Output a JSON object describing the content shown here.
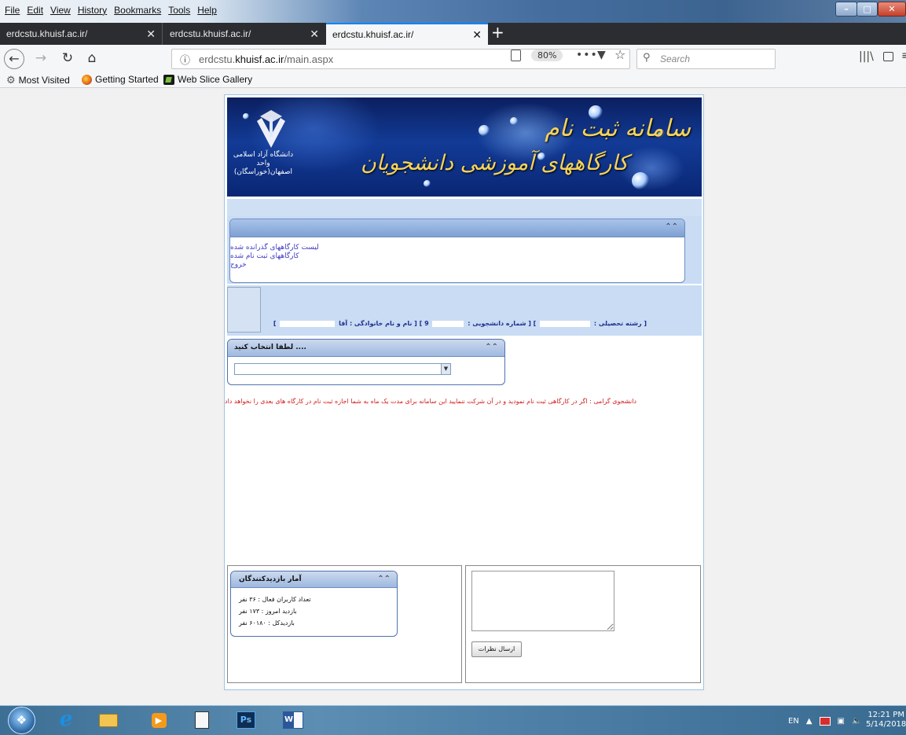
{
  "browser": {
    "menu": [
      "File",
      "Edit",
      "View",
      "History",
      "Bookmarks",
      "Tools",
      "Help"
    ],
    "tabs": [
      {
        "title": "erdcstu.khuisf.ac.ir/"
      },
      {
        "title": "erdcstu.khuisf.ac.ir/"
      },
      {
        "title": "erdcstu.khuisf.ac.ir/"
      }
    ],
    "new_tab_label": "+",
    "url_prefix": "erdcstu.",
    "url_domain": "khuisf.ac.ir",
    "url_path": "/main.aspx",
    "zoom": "80%",
    "page_actions": "•••",
    "search_placeholder": "Search",
    "bookmarks": [
      "Most Visited",
      "Getting Started",
      "Web Slice Gallery"
    ],
    "icons": [
      "back-icon",
      "forward-icon",
      "reload-icon",
      "home-icon",
      "info-icon",
      "reader-view-icon",
      "pocket-icon",
      "star-icon",
      "search-icon",
      "library-icon",
      "sidebar-icon",
      "menu-icon"
    ]
  },
  "page": {
    "banner": {
      "university_line1": "دانشگاه آزاد اسلامی",
      "university_line2": "واحد اصفهان(خوراسگان)",
      "title": "سامانه ثبت نام",
      "subtitle": "کارگاههای آموزشی دانشجویان"
    },
    "menu_links": [
      "لیست کارگاههای گذرانده شده",
      "کارگاههای ثبت نام شده",
      "خروج"
    ],
    "student_info": {
      "field_label": "[ رشته تحصیلی :",
      "student_no_label": "] [ شماره دانشجویی :",
      "name_label": "] [ نام و نام خانوادگی : آقا",
      "closing": "]",
      "digit": "9"
    },
    "select_panel": {
      "title": ".... لطفا انتخاب کنید",
      "value": ""
    },
    "warning": "دانشجوی گرامی : اگر در کارگاهی ثبت نام نمودید و در آن شرکت ننمایید این سامانه برای مدت یک ماه به شما اجازه ثبت نام در کارگاه های بعدی را نخواهد داد",
    "stats": {
      "title": "آمار بازدیدکنندگان",
      "active_users": "تعداد کاربران فعال : ۳۶ نفر",
      "today_visits": "بازدید امروز : ۱۷۳ نفر",
      "total_visits": "بازدیدکل : ۶۰۱۸۰ نفر"
    },
    "comments": {
      "text": "",
      "button_label": "ارسال نظرات"
    }
  },
  "taskbar": {
    "items": [
      "start-orb",
      "internet-explorer",
      "windows-explorer",
      "media-player",
      "calculator",
      "photoshop",
      "word"
    ],
    "ps_label": "Ps",
    "word_label": "W",
    "language": "EN",
    "time": "12:21 PM",
    "date": "5/14/2018"
  },
  "colors": {
    "accent_tab": "#0a84ff",
    "warning_red": "#d21c1c",
    "link_blue": "#3e39c6",
    "banner_gold": "#f4d35a"
  }
}
